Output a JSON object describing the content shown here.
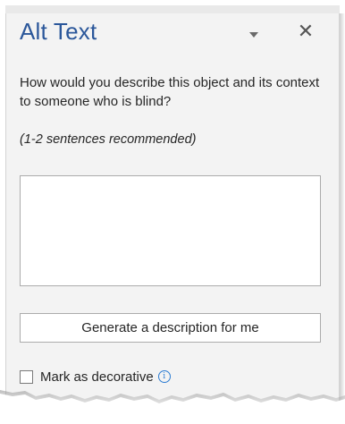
{
  "panel": {
    "title": "Alt Text",
    "question": "How would you describe this object and its context to someone who is blind?",
    "hint": "(1-2 sentences recommended)",
    "description_value": "",
    "generate_button_label": "Generate a description for me",
    "decorative_label": "Mark as decorative",
    "decorative_checked": false,
    "close_symbol": "✕",
    "info_symbol": "i"
  },
  "icons": {
    "dropdown": "chevron-down-icon",
    "close": "close-icon",
    "info": "info-icon"
  },
  "colors": {
    "title": "#2b579a",
    "pane_background": "#f3f3f3",
    "info_accent": "#2b7cd3",
    "text": "#262626"
  }
}
